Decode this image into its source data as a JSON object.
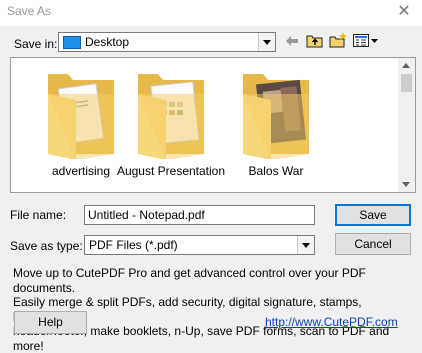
{
  "window": {
    "title": "Save As",
    "close_glyph": "✕"
  },
  "save_in": {
    "label": "Save in:",
    "value": "Desktop"
  },
  "toolbar": {
    "icons": [
      "back-arrow-icon",
      "up-folder-icon",
      "new-folder-icon",
      "view-menu-icon"
    ]
  },
  "files": [
    {
      "name": "advertising",
      "icon": "folder-icon"
    },
    {
      "name": "August Presentation",
      "icon": "folder-icon"
    },
    {
      "name": "Balos War",
      "icon": "folder-icon"
    }
  ],
  "file_name": {
    "label": "File name:",
    "value": "Untitled - Notepad.pdf"
  },
  "save_as_type": {
    "label": "Save as type:",
    "value": "PDF Files (*.pdf)"
  },
  "buttons": {
    "save": "Save",
    "cancel": "Cancel",
    "help": "Help"
  },
  "promo": {
    "line1": "Move up to CutePDF Pro and get advanced control over your PDF documents.",
    "line2": "Easily merge & split PDFs, add security, digital signature, stamps, bookmarks or",
    "line3": "header/footer, make booklets, n-Up, save PDF forms, scan to PDF and more!"
  },
  "link": {
    "text": "http://www.CutePDF.com"
  },
  "colors": {
    "accent": "#0078d7",
    "folder": "#f2c95e",
    "link": "#0645ad"
  }
}
